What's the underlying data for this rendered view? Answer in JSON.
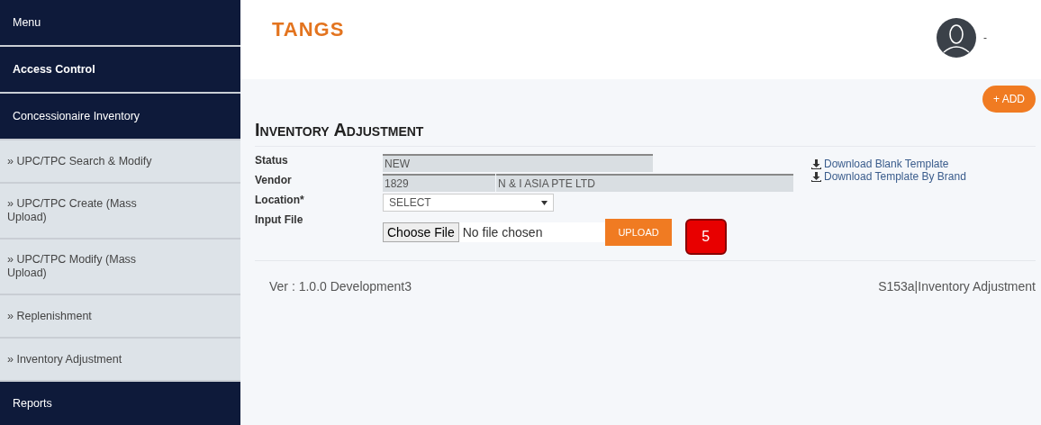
{
  "sidebar": {
    "items": [
      {
        "label": "Menu",
        "kind": "section",
        "bold": false
      },
      {
        "label": "Access Control",
        "kind": "section",
        "bold": true
      },
      {
        "label": "Concessionaire Inventory",
        "kind": "section",
        "bold": false
      },
      {
        "label": "» UPC/TPC Search & Modify",
        "kind": "link"
      },
      {
        "label": "» UPC/TPC Create (Mass Upload)",
        "kind": "link"
      },
      {
        "label": "» UPC/TPC Modify (Mass Upload)",
        "kind": "link"
      },
      {
        "label": "» Replenishment",
        "kind": "link"
      },
      {
        "label": "» Inventory Adjustment",
        "kind": "link"
      },
      {
        "label": "Reports",
        "kind": "section",
        "bold": false
      }
    ]
  },
  "header": {
    "logo": "TANGS",
    "user_caret": "-"
  },
  "add_button": "+ ADD",
  "page_title": "Inventory Adjustment",
  "form": {
    "status": {
      "label": "Status",
      "value": "NEW"
    },
    "vendor": {
      "label": "Vendor",
      "code": "1829",
      "name": "N & I ASIA PTE LTD"
    },
    "location": {
      "label": "Location*",
      "value": "SELECT"
    },
    "input_file": {
      "label": "Input File",
      "button": "Choose File",
      "file_text": "No file chosen",
      "upload": "UPLOAD"
    },
    "badge": "5"
  },
  "downloads": [
    "Download Blank Template",
    "Download Template By Brand"
  ],
  "footer": {
    "version": "Ver : 1.0.0 Development3",
    "screen": "S153a|Inventory Adjustment"
  }
}
